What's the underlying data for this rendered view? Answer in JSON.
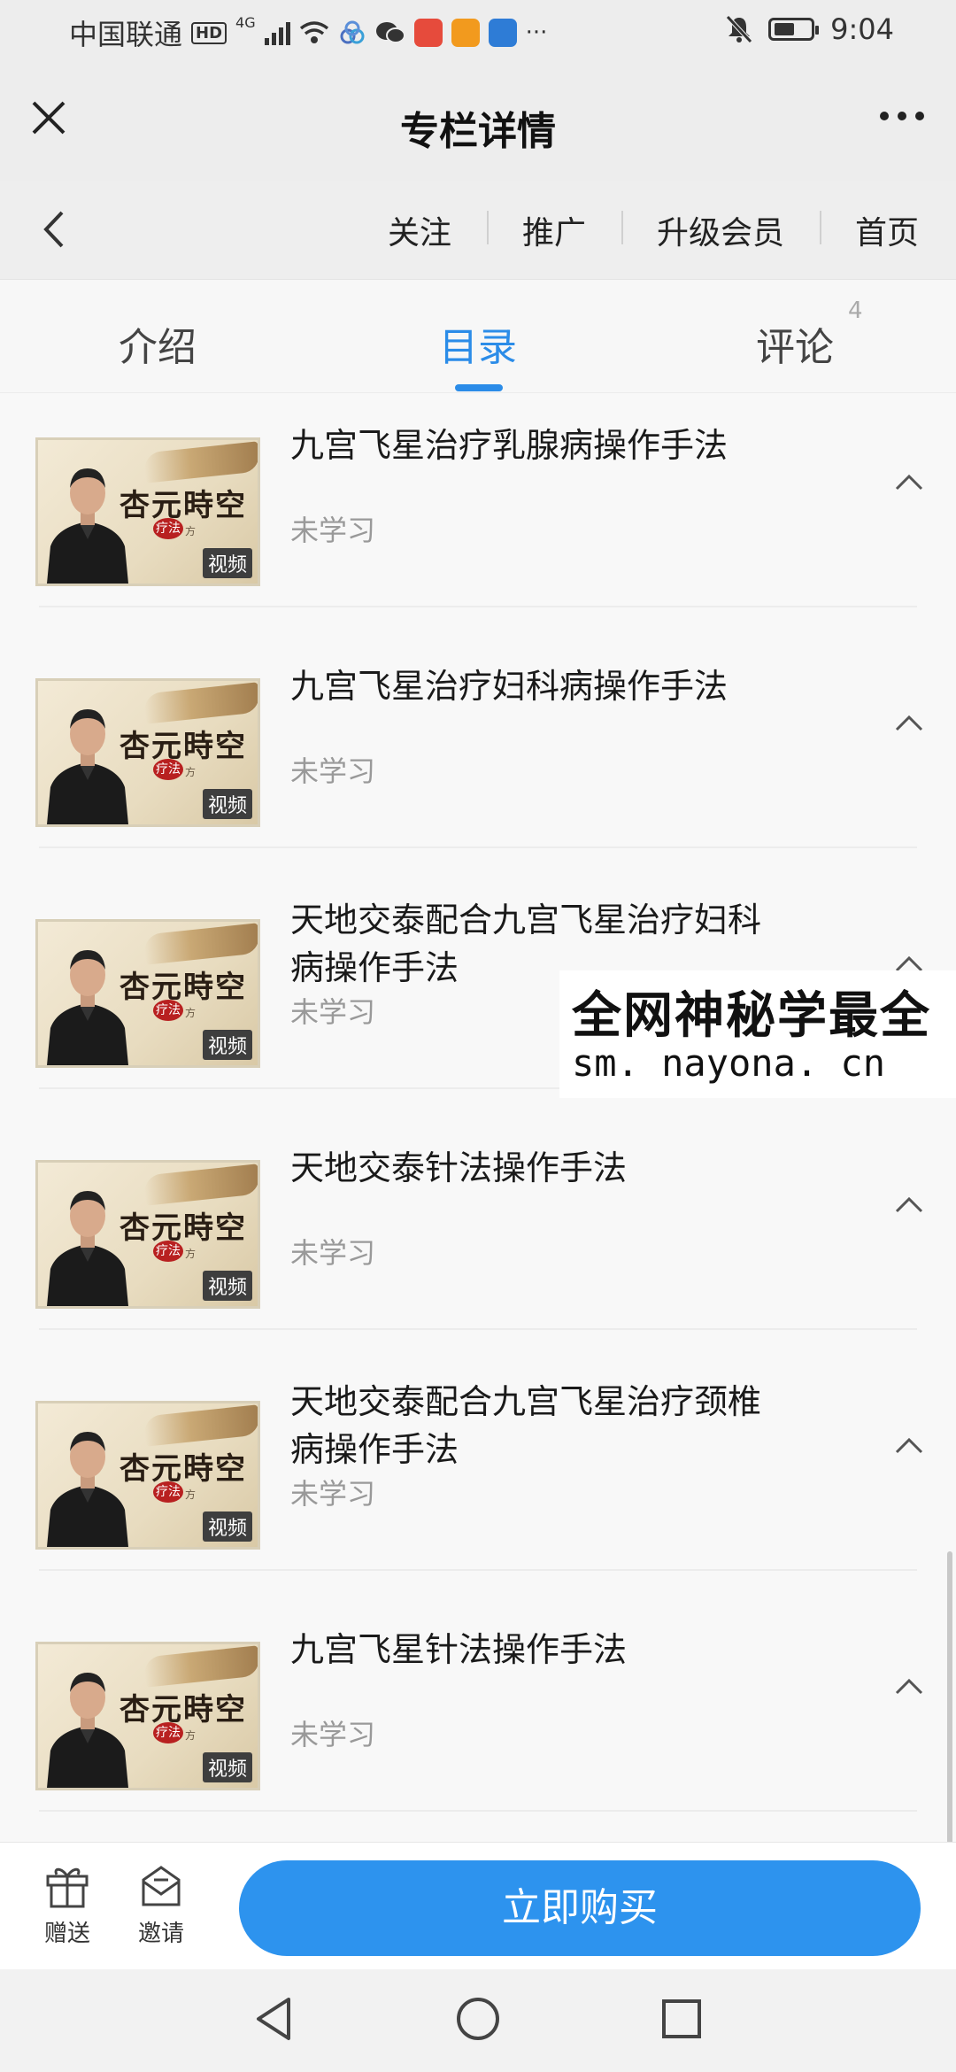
{
  "status_bar": {
    "carrier": "中国联通",
    "hd": "HD",
    "network": "4G",
    "time": "9:04"
  },
  "header": {
    "title": "专栏详情"
  },
  "subnav": {
    "links": [
      "关注",
      "推广",
      "升级会员",
      "首页"
    ]
  },
  "tabs": {
    "items": [
      "介绍",
      "目录",
      "评论"
    ],
    "active": "目录",
    "comment_count": "4",
    "accent_color": "#2b8ce8"
  },
  "list": {
    "items": [
      {
        "title": "九宫飞星治疗乳腺病操作手法",
        "status": "未学习",
        "badge": "视频"
      },
      {
        "title": "九宫飞星治疗妇科病操作手法",
        "status": "未学习",
        "badge": "视频"
      },
      {
        "title": "天地交泰配合九宫飞星治疗妇科病操作手法",
        "status": "未学习",
        "badge": "视频"
      },
      {
        "title": "天地交泰针法操作手法",
        "status": "未学习",
        "badge": "视频"
      },
      {
        "title": "天地交泰配合九宫飞星治疗颈椎病操作手法",
        "status": "未学习",
        "badge": "视频"
      },
      {
        "title": "九宫飞星针法操作手法",
        "status": "未学习",
        "badge": "视频"
      }
    ],
    "thumbnail": {
      "title": "杏元時空",
      "seal": "疗法",
      "sub": "方"
    }
  },
  "watermark": {
    "line1": "全网神秘学最全",
    "line2": "sm. nayona. cn"
  },
  "bottom_bar": {
    "gift_label": "赠送",
    "invite_label": "邀请",
    "buy_label": "立即购买",
    "buy_color": "#2d93ee"
  }
}
